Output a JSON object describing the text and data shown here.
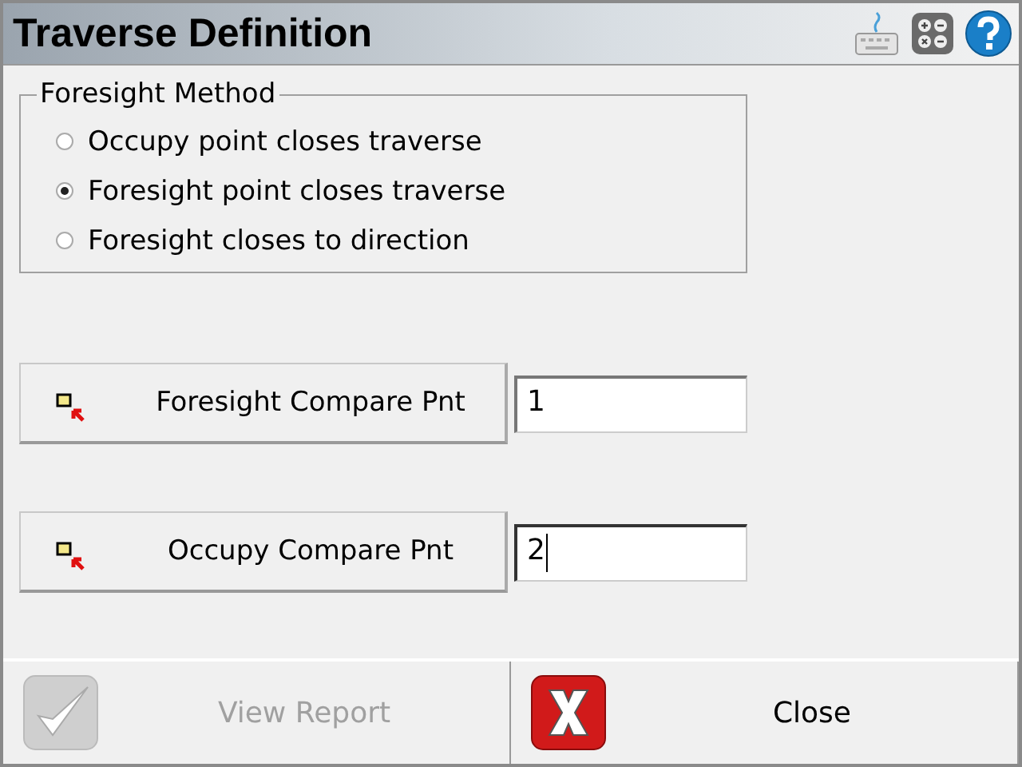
{
  "window": {
    "title": "Traverse Definition"
  },
  "foresight_method": {
    "label": "Foresight Method",
    "options": [
      {
        "label": "Occupy point closes traverse",
        "selected": false
      },
      {
        "label": "Foresight point closes traverse",
        "selected": true
      },
      {
        "label": "Foresight closes to direction",
        "selected": false
      }
    ]
  },
  "compare_points": [
    {
      "label": "Foresight Compare Pnt",
      "value": "1",
      "focused": false
    },
    {
      "label": "Occupy Compare Pnt",
      "value": "2",
      "focused": true
    }
  ],
  "buttons": [
    {
      "label": "View Report",
      "kind": "check",
      "disabled": true
    },
    {
      "label": "Close",
      "kind": "close",
      "disabled": false
    }
  ]
}
